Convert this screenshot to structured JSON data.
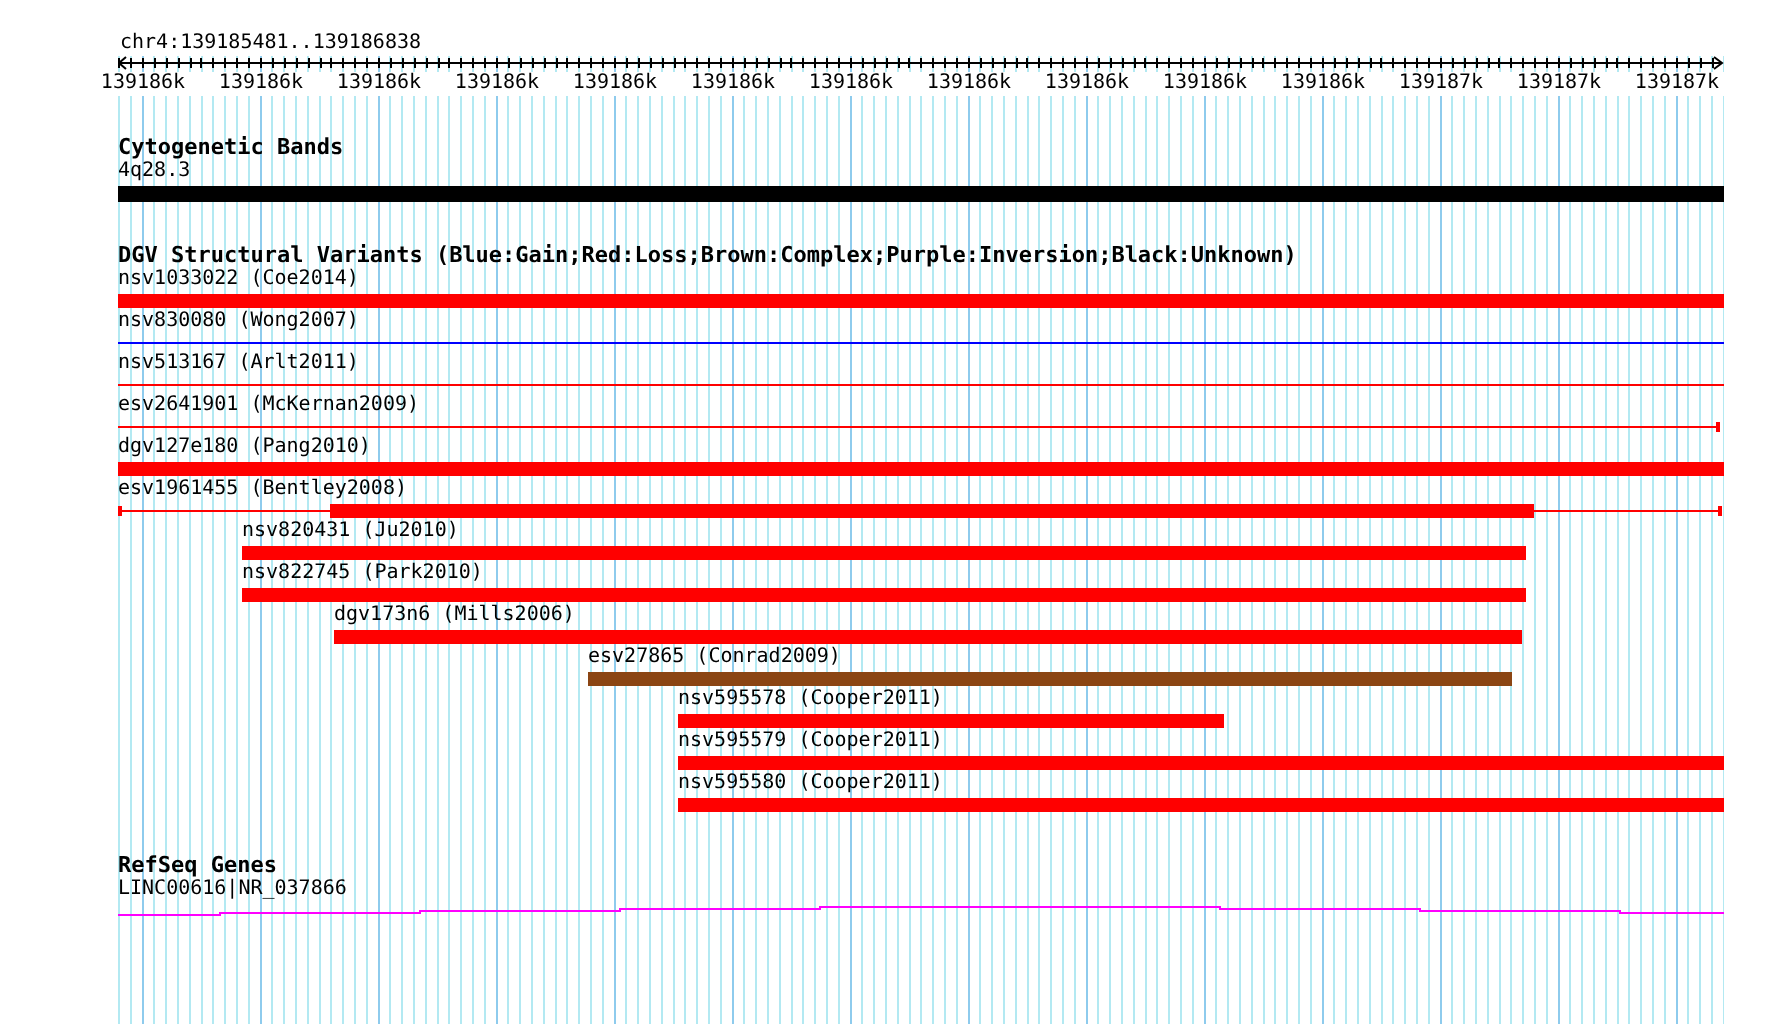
{
  "ruler": {
    "location": "chr4:139185481..139186838",
    "ticks": [
      "139186k",
      "139186k",
      "139186k",
      "139186k",
      "139186k",
      "139186k",
      "139186k",
      "139186k",
      "139186k",
      "139186k",
      "139186k",
      "139187k",
      "139187k",
      "139187k"
    ]
  },
  "cytobands": {
    "title": "Cytogenetic Bands",
    "label": "4q28.3"
  },
  "variants_track": {
    "title": "DGV Structural Variants (Blue:Gain;Red:Loss;Brown:Complex;Purple:Inversion;Black:Unknown)",
    "variants": [
      {
        "label": "nsv1033022 (Coe2014)",
        "color": "#ff0000",
        "kind": "thick"
      },
      {
        "label": "nsv830080 (Wong2007)",
        "color": "#0000ff",
        "kind": "thin"
      },
      {
        "label": "nsv513167 (Arlt2011)",
        "color": "#ff0000",
        "kind": "thin"
      },
      {
        "label": "esv2641901 (McKernan2009)",
        "color": "#ff0000",
        "kind": "capped"
      },
      {
        "label": "dgv127e180 (Pang2010)",
        "color": "#ff0000",
        "kind": "thick"
      },
      {
        "label": "esv1961455 (Bentley2008)",
        "color": "#ff0000",
        "kind": "split"
      },
      {
        "label": "nsv820431 (Ju2010)",
        "color": "#ff0000",
        "kind": "thick"
      },
      {
        "label": "nsv822745 (Park2010)",
        "color": "#ff0000",
        "kind": "thick"
      },
      {
        "label": "dgv173n6 (Mills2006)",
        "color": "#ff0000",
        "kind": "thick"
      },
      {
        "label": "esv27865 (Conrad2009)",
        "color": "#8b4513",
        "kind": "thick"
      },
      {
        "label": "nsv595578 (Cooper2011)",
        "color": "#ff0000",
        "kind": "thick"
      },
      {
        "label": "nsv595579 (Cooper2011)",
        "color": "#ff0000",
        "kind": "thick"
      },
      {
        "label": "nsv595580 (Cooper2011)",
        "color": "#ff0000",
        "kind": "thick"
      }
    ]
  },
  "genes": {
    "title": "RefSeq Genes",
    "label": "LINC00616|NR_037866"
  }
}
